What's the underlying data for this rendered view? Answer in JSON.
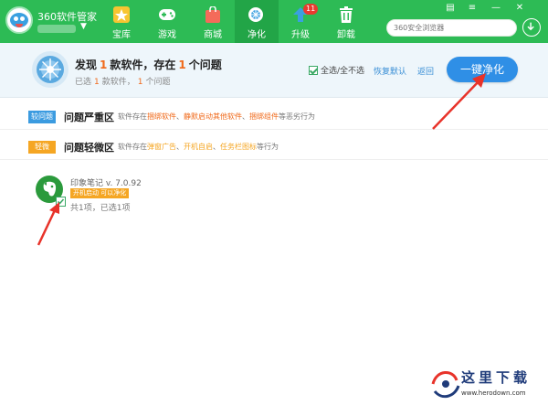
{
  "app": {
    "title": "360软件管家",
    "brand_color": "#2dbb55",
    "accent_color": "#2f8fe6",
    "highlight_color": "#f06a1b"
  },
  "nav": [
    {
      "label": "宝库",
      "icon": "star-icon"
    },
    {
      "label": "游戏",
      "icon": "gamepad-icon"
    },
    {
      "label": "商城",
      "icon": "shopping-bag-icon"
    },
    {
      "label": "净化",
      "icon": "purify-icon",
      "active": true
    },
    {
      "label": "升级",
      "icon": "upgrade-arrow-icon",
      "badge": "11"
    },
    {
      "label": "卸载",
      "icon": "trash-icon"
    }
  ],
  "window_controls": [
    "skin-icon",
    "menu-icon",
    "minimize-icon",
    "close-icon"
  ],
  "search": {
    "placeholder": "360安全浏览器"
  },
  "summary": {
    "prefix": "发现",
    "software_count": "1",
    "middle": "款软件，存在",
    "issue_count": "1",
    "suffix": "个问题",
    "sub_prefix": "已选",
    "sub_software_count": "1",
    "sub_middle": "款软件，",
    "sub_issue_count": "1",
    "sub_suffix": "个问题",
    "select_all_label": "全选/全不选",
    "restore_default_label": "恢复默认",
    "back_label": "返回",
    "primary_button_label": "一键净化"
  },
  "sections": {
    "serious": {
      "tag": "较问题",
      "title": "问题严重区",
      "desc_prefix": "软件存在",
      "hl1": "捆绑软件",
      "sep1": "、",
      "hl2": "静默启动其他软件",
      "sep2": "、",
      "hl3": "捆绑组件",
      "desc_suffix": "等恶劣行为"
    },
    "mild": {
      "tag": "轻微",
      "title": "问题轻微区",
      "desc_prefix": "软件存在",
      "hl1": "弹窗广告",
      "sep1": "、",
      "hl2": "开机自启",
      "sep2": "、",
      "hl3": "任务栏图标",
      "desc_suffix": "等行为"
    }
  },
  "app_item": {
    "name": "印象笔记 v. 7.0.92",
    "icon": "evernote-elephant-icon",
    "badge": "开机启动 可以净化",
    "count": "共1项，已选1项"
  },
  "watermark": {
    "title": "这里下载",
    "url": "www.herodown.com"
  }
}
